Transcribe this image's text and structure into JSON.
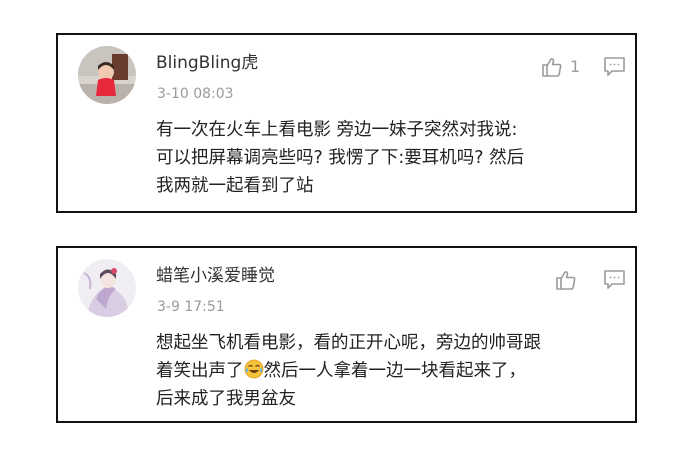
{
  "comments": [
    {
      "username": "BlingBling虎",
      "time": "3-10 08:03",
      "likes": "1",
      "lines": [
        "有一次在火车上看电影 旁边一妹子突然对我说:",
        "可以把屏幕调亮些吗? 我愣了下:要耳机吗? 然后",
        "我两就一起看到了站"
      ]
    },
    {
      "username": "蜡笔小溪爱睡觉",
      "time": "3-9 17:51",
      "lines": [
        "想起坐飞机看电影，看的正开心呢，旁边的帅哥跟",
        "着笑出声了",
        "然后一人拿着一边一块看起来了，",
        "后来成了我男盆友"
      ]
    }
  ],
  "icons": {
    "like": "thumbs-up-icon",
    "reply": "comment-icon",
    "emoji": "tears-of-joy-emoji-icon"
  },
  "colors": {
    "border": "#111111",
    "username": "#333333",
    "meta": "#9b9b9b",
    "text": "#222222"
  }
}
